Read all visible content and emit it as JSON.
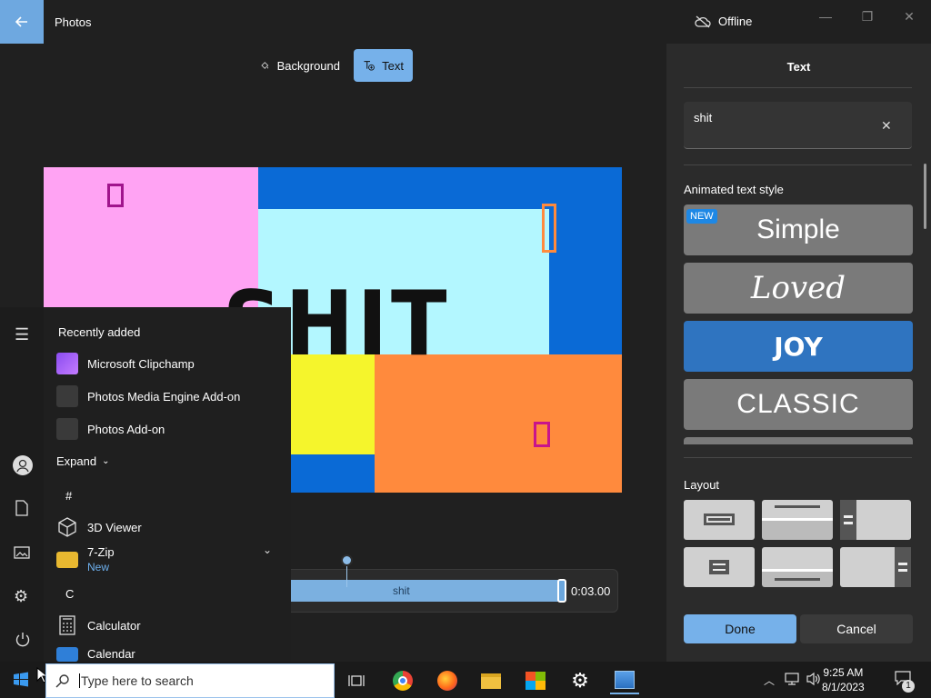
{
  "app": {
    "title": "Photos",
    "status": "Offline"
  },
  "toolbar": {
    "background": "Background",
    "text": "Text"
  },
  "canvas": {
    "overlay_text": "SHIT"
  },
  "timeline": {
    "clip_label": "shit",
    "duration": "0:03.00"
  },
  "panel": {
    "title": "Text",
    "text_value": "shit",
    "animated_label": "Animated text style",
    "styles": [
      {
        "label": "Simple",
        "badge": "NEW"
      },
      {
        "label": "Loved"
      },
      {
        "label": "JOY"
      },
      {
        "label": "CLASSIC"
      }
    ],
    "layout_label": "Layout",
    "done": "Done",
    "cancel": "Cancel"
  },
  "start_menu": {
    "recently_added": "Recently added",
    "recent": [
      {
        "label": "Microsoft Clipchamp"
      },
      {
        "label": "Photos Media Engine Add-on"
      },
      {
        "label": "Photos Add-on"
      }
    ],
    "expand": "Expand",
    "hash": "#",
    "apps": [
      {
        "label": "3D Viewer"
      },
      {
        "label": "7-Zip",
        "sub": "New"
      }
    ],
    "letter_c": "C",
    "c_apps": [
      {
        "label": "Calculator"
      },
      {
        "label": "Calendar"
      }
    ]
  },
  "taskbar": {
    "search_placeholder": "Type here to search",
    "time": "9:25 AM",
    "date": "8/1/2023",
    "notif_count": "1"
  },
  "colors": {
    "accent": "#76b1ea",
    "pink": "#ffa3f3",
    "cyan": "#b3f7ff",
    "yellow": "#f5f52c",
    "orange": "#ff8a3d",
    "blue": "#0a6ad6"
  }
}
